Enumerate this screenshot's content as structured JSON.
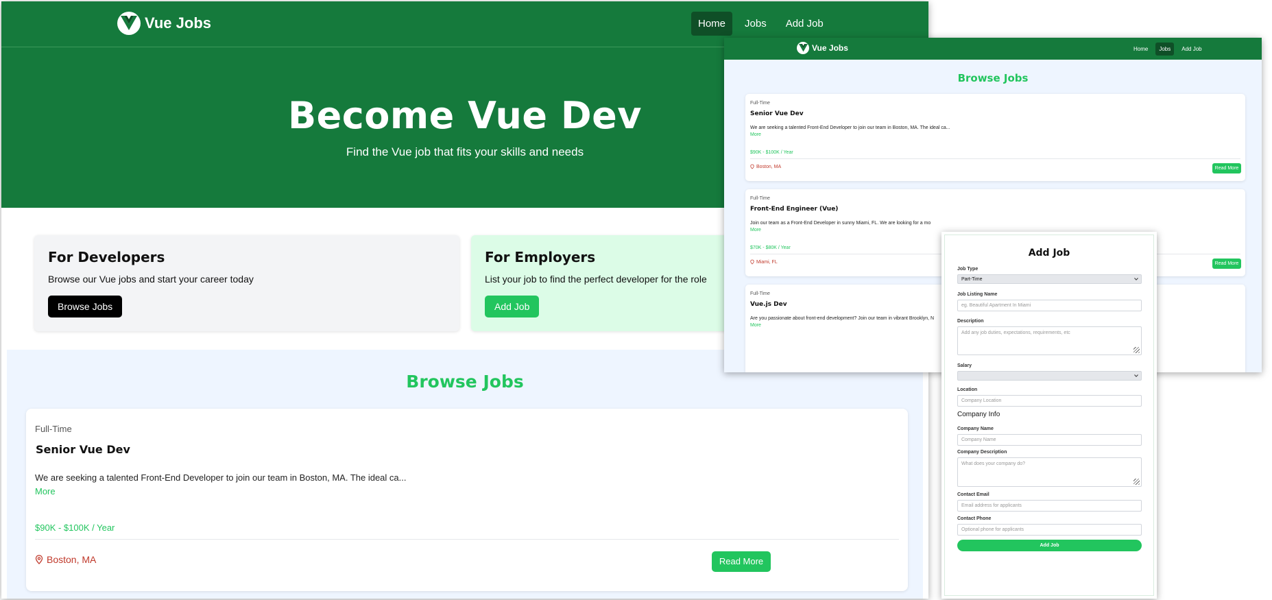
{
  "brand": "Vue Jobs",
  "nav": {
    "home": "Home",
    "jobs": "Jobs",
    "add": "Add Job"
  },
  "hero": {
    "title": "Become Vue Dev",
    "subtitle": "Find the Vue job that fits your skills and needs"
  },
  "cards": {
    "dev": {
      "title": "For Developers",
      "text": "Browse our Vue jobs and start your career today",
      "button": "Browse Jobs"
    },
    "emp": {
      "title": "For Employers",
      "text": "List your job to find the perfect developer for the role",
      "button": "Add Job"
    }
  },
  "browse_title": "Browse Jobs",
  "jobs": [
    {
      "type": "Full-Time",
      "title": "Senior Vue Dev",
      "desc": "We are seeking a talented Front-End Developer to join our team in Boston, MA. The ideal ca...",
      "more": "More",
      "salary": "$90K - $100K / Year",
      "location": "Boston, MA",
      "button": "Read More"
    },
    {
      "type": "Full-Time",
      "title": "Front-End Engineer (Vue)",
      "desc": "Join our team as a Front-End Developer in sunny Miami, FL. We are looking for a mo",
      "more": "More",
      "salary": "$70K - $80K / Year",
      "location": "Miami, FL",
      "button": "Read More"
    },
    {
      "type": "Full-Time",
      "title": "Vue.js Dev",
      "desc": "Are you passionate about front-end development? Join our team in vibrant Brooklyn, N",
      "more": "More"
    }
  ],
  "form": {
    "title": "Add Job",
    "job_type_label": "Job Type",
    "job_type_value": "Part-Time",
    "listing_label": "Job Listing Name",
    "listing_placeholder": "eg. Beautiful Apartment In Miami",
    "desc_label": "Description",
    "desc_placeholder": "Add any job duties, expectations, requirements, etc",
    "salary_label": "Salary",
    "location_label": "Location",
    "location_placeholder": "Company Location",
    "company_info": "Company Info",
    "company_name_label": "Company Name",
    "company_name_placeholder": "Company Name",
    "company_desc_label": "Company Description",
    "company_desc_placeholder": "What does your company do?",
    "email_label": "Contact Email",
    "email_placeholder": "Email address for applicants",
    "phone_label": "Contact Phone",
    "phone_placeholder": "Optional phone for applicants",
    "submit": "Add Job"
  },
  "colors": {
    "nav_green": "#157a3c",
    "accent_green": "#22c55e",
    "location_red": "#c0392b",
    "browse_bg": "#eef5ff"
  },
  "icons": {
    "logo": "vue-logo",
    "location": "map-pin-icon",
    "dropdown": "chevron-down-icon"
  }
}
